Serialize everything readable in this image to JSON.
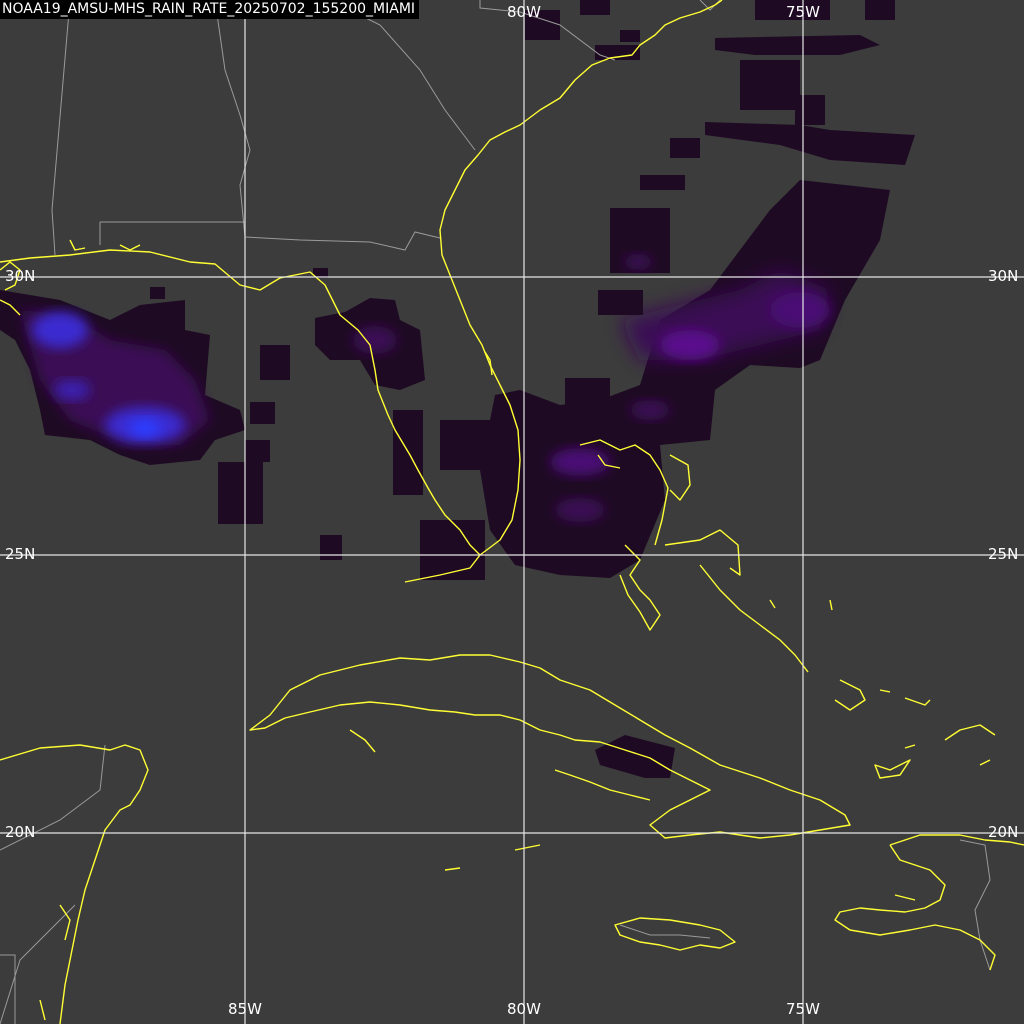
{
  "title": "NOAA19_AMSU-MHS_RAIN_RATE_20250702_155200_MIAMI",
  "grid": {
    "lon_labels": [
      "85W",
      "80W",
      "75W"
    ],
    "lat_labels": [
      "30N",
      "25N",
      "20N"
    ]
  },
  "colors": {
    "background": "#3c3c3c",
    "coastline": "#ffff33",
    "borders": "#9a9a9a",
    "gridlines": "#e6e6e6",
    "rain_low": "#1e0a23",
    "rain_mid": "#5a0a8c",
    "rain_high": "#1e32ff"
  },
  "legend": []
}
